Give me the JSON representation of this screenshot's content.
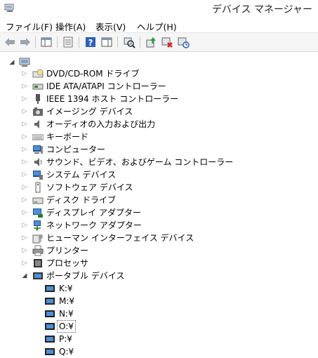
{
  "window": {
    "title": "デバイス マネージャー"
  },
  "menu": [
    "ファイル(F)",
    "操作(A)",
    "表示(V)",
    "ヘルプ(H)"
  ],
  "toolbar": {
    "buttons": [
      "back-icon",
      "forward-icon",
      "show-hide-console-tree-icon",
      "properties-sheet-icon",
      "help-icon",
      "action-pane-icon",
      "scan-hardware-icon",
      "update-driver-icon",
      "disable-device-icon",
      "uninstall-device-icon"
    ]
  },
  "tree": {
    "categories": [
      {
        "label": "DVD/CD-ROM ドライブ",
        "icon": "dvd-drive-icon",
        "expanded": false
      },
      {
        "label": "IDE ATA/ATAPI コントローラー",
        "icon": "ide-controller-icon",
        "expanded": false
      },
      {
        "label": "IEEE 1394 ホスト コントローラー",
        "icon": "ieee1394-icon",
        "expanded": false
      },
      {
        "label": "イメージング デバイス",
        "icon": "camera-icon",
        "expanded": false
      },
      {
        "label": "オーディオの入力および出力",
        "icon": "speaker-icon",
        "expanded": false
      },
      {
        "label": "キーボード",
        "icon": "keyboard-icon",
        "expanded": false
      },
      {
        "label": "コンピューター",
        "icon": "computer-icon",
        "expanded": false
      },
      {
        "label": "サウンド、ビデオ、およびゲーム コントローラー",
        "icon": "sound-icon",
        "expanded": false
      },
      {
        "label": "システム デバイス",
        "icon": "system-device-icon",
        "expanded": false
      },
      {
        "label": "ソフトウェア デバイス",
        "icon": "software-device-icon",
        "expanded": false
      },
      {
        "label": "ディスク ドライブ",
        "icon": "disk-drive-icon",
        "expanded": false
      },
      {
        "label": "ディスプレイ アダプター",
        "icon": "display-adapter-icon",
        "expanded": false
      },
      {
        "label": "ネットワーク アダプター",
        "icon": "network-adapter-icon",
        "expanded": false
      },
      {
        "label": "ヒューマン インターフェイス デバイス",
        "icon": "hid-icon",
        "expanded": false
      },
      {
        "label": "プリンター",
        "icon": "printer-icon",
        "expanded": false
      },
      {
        "label": "プロセッサ",
        "icon": "processor-icon",
        "expanded": false
      },
      {
        "label": "ポータブル デバイス",
        "icon": "portable-device-icon",
        "expanded": true
      }
    ],
    "portable_devices": [
      "K:¥",
      "M:¥",
      "N:¥",
      "O:¥",
      "P:¥",
      "Q:¥"
    ],
    "selected_device": "O:¥"
  }
}
